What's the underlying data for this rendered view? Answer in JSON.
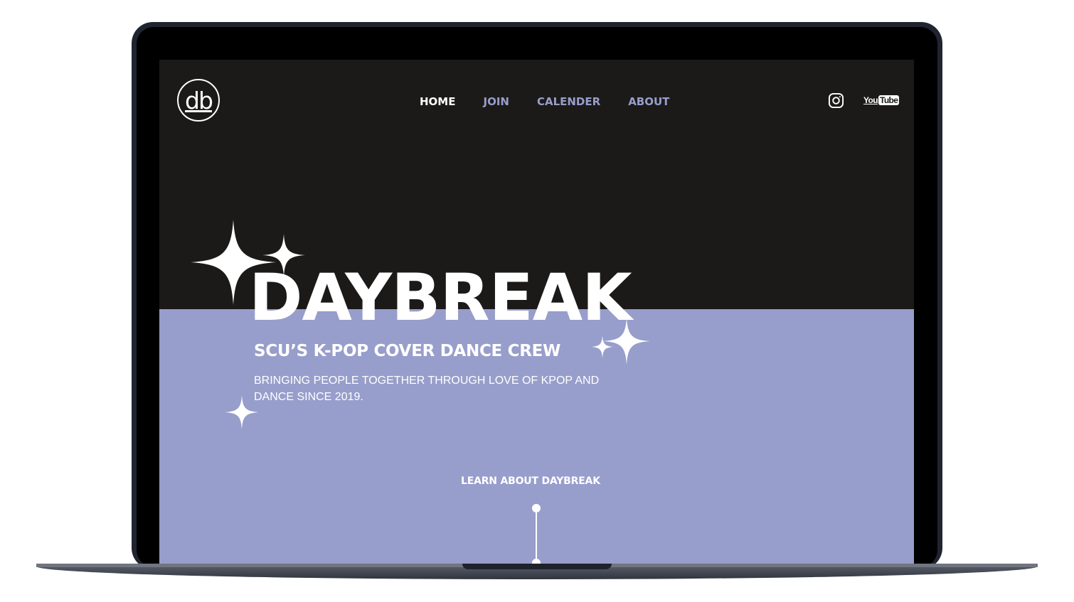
{
  "logo": {
    "text": "db"
  },
  "nav": {
    "items": [
      {
        "label": "HOME",
        "active": true
      },
      {
        "label": "JOIN",
        "active": false
      },
      {
        "label": "CALENDER",
        "active": false
      },
      {
        "label": "ABOUT",
        "active": false
      }
    ]
  },
  "social": {
    "instagram_icon": "instagram-icon",
    "youtube": {
      "you": "You",
      "tube": "Tube"
    }
  },
  "hero": {
    "title": "DAYBREAK",
    "subtitle": "SCU’S K-POP COVER DANCE CREW",
    "tagline": "BRINGING PEOPLE TOGETHER THROUGH LOVE OF KPOP AND DANCE SINCE 2019.",
    "cta_label": "LEARN ABOUT DAYBREAK"
  },
  "colors": {
    "dark_background": "#1b1a19",
    "accent_lavender": "#979ecb",
    "text": "#ffffff"
  }
}
